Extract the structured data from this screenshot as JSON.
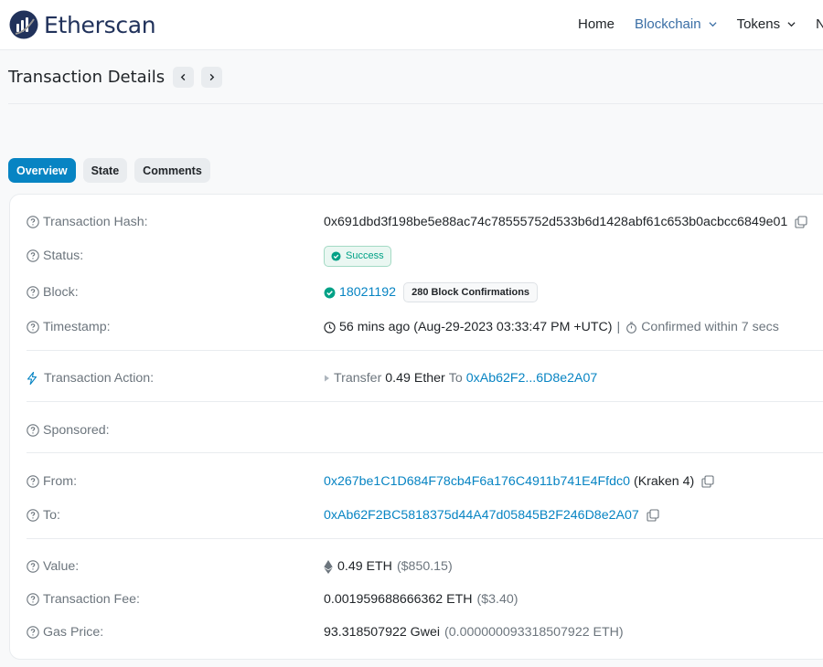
{
  "header": {
    "logo_text": "Etherscan",
    "nav": [
      {
        "label": "Home",
        "dropdown": false,
        "active": false
      },
      {
        "label": "Blockchain",
        "dropdown": true,
        "active": true
      },
      {
        "label": "Tokens",
        "dropdown": true,
        "active": false
      },
      {
        "label": "NF",
        "dropdown": false,
        "active": false
      }
    ]
  },
  "title": "Transaction Details",
  "tabs": [
    "Overview",
    "State",
    "Comments"
  ],
  "details": {
    "tx_hash": {
      "label": "Transaction Hash:",
      "value": "0x691dbd3f198be5e88ac74c78555752d533b6d1428abf61c653b0acbcc6849e01"
    },
    "status": {
      "label": "Status:",
      "value": "Success"
    },
    "block": {
      "label": "Block:",
      "value": "18021192",
      "confirmations": "280 Block Confirmations"
    },
    "timestamp": {
      "label": "Timestamp:",
      "value": "56 mins ago (Aug-29-2023 03:33:47 PM +UTC)",
      "separator": "|",
      "confirmed": "Confirmed within 7 secs"
    },
    "action": {
      "label": "Transaction Action:",
      "verb": "Transfer",
      "amount": "0.49 Ether",
      "to_word": "To",
      "to_address": "0xAb62F2...6D8e2A07"
    },
    "sponsored": {
      "label": "Sponsored:"
    },
    "from": {
      "label": "From:",
      "address": "0x267be1C1D684F78cb4F6a176C4911b741E4Ffdc0",
      "tag": "(Kraken 4)"
    },
    "to": {
      "label": "To:",
      "address": "0xAb62F2BC5818375d44A47d05845B2F246D8e2A07"
    },
    "value": {
      "label": "Value:",
      "amount": "0.49 ETH",
      "usd": "($850.15)"
    },
    "fee": {
      "label": "Transaction Fee:",
      "amount": "0.001959688666362 ETH",
      "usd": "($3.40)"
    },
    "gas": {
      "label": "Gas Price:",
      "gwei": "93.318507922 Gwei",
      "eth": "(0.000000093318507922 ETH)"
    }
  },
  "colors": {
    "accent": "#0784c3",
    "success": "#00a186",
    "muted": "#6c757d"
  }
}
